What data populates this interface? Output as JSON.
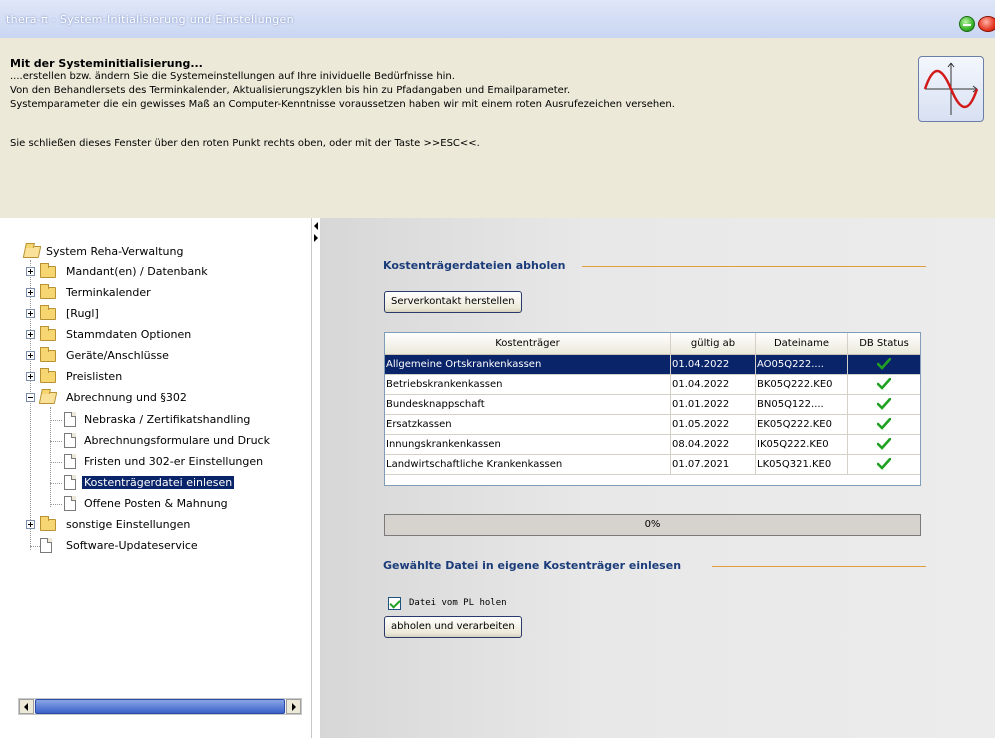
{
  "window": {
    "title": "thera-π - System-Initialisierung und Einstellungen"
  },
  "header": {
    "heading": "Mit der Systeminitialisierung...",
    "line1": "....erstellen bzw. ändern Sie die Systemeinstellungen auf Ihre inividuelle Bedürfnisse hin.",
    "line2": "Von den Behandlersets des Terminkalender, Aktualisierungszyklen bis hin zu Pfadangaben und Emailparameter.",
    "line3": "Systemparameter die ein gewisses Maß an Computer-Kenntnisse voraussetzen haben wir mit einem roten Ausrufezeichen versehen.",
    "line4": "Sie schließen dieses Fenster über den roten Punkt rechts oben, oder mit der Taste >>ESC<<."
  },
  "tree": {
    "root": "System Reha-Verwaltung",
    "items": [
      "Mandant(en) / Datenbank",
      "Terminkalender",
      "[Rugl]",
      "Stammdaten Optionen",
      "Geräte/Anschlüsse",
      "Preislisten",
      "Abrechnung und §302",
      "sonstige Einstellungen",
      "Software-Updateservice"
    ],
    "children": [
      "Nebraska / Zertifikatshandling",
      "Abrechnungsformulare und Druck",
      "Fristen und 302-er Einstellungen",
      "Kostenträgerdatei einlesen",
      "Offene Posten & Mahnung"
    ]
  },
  "section1": {
    "title": "Kostenträgerdateien abholen",
    "button": "Serverkontakt herstellen"
  },
  "table": {
    "headers": [
      "Kostenträger",
      "gültig ab",
      "Dateiname",
      "DB Status"
    ],
    "rows": [
      [
        "Allgemeine Ortskrankenkassen",
        "01.04.2022",
        "AO05Q222...."
      ],
      [
        "Betriebskrankenkassen",
        "01.04.2022",
        "BK05Q222.KE0"
      ],
      [
        "Bundesknappschaft",
        "01.01.2022",
        "BN05Q122...."
      ],
      [
        "Ersatzkassen",
        "01.05.2022",
        "EK05Q222.KE0"
      ],
      [
        "Innungskrankenkassen",
        "08.04.2022",
        "IK05Q222.KE0"
      ],
      [
        "Landwirtschaftliche Krankenkassen",
        "01.07.2021",
        "LK05Q321.KE0"
      ]
    ]
  },
  "progress": {
    "text": "0%",
    "value": 0
  },
  "section2": {
    "title": "Gewählte Datei in eigene Kostenträger einlesen",
    "checkbox_label": "Datei vom PL holen",
    "button": "abholen und verarbeiten"
  },
  "colors": {
    "accent": "#1b3c7a",
    "selection": "#0a246a",
    "section_line": "#e39c3e",
    "check": "#21a121"
  }
}
